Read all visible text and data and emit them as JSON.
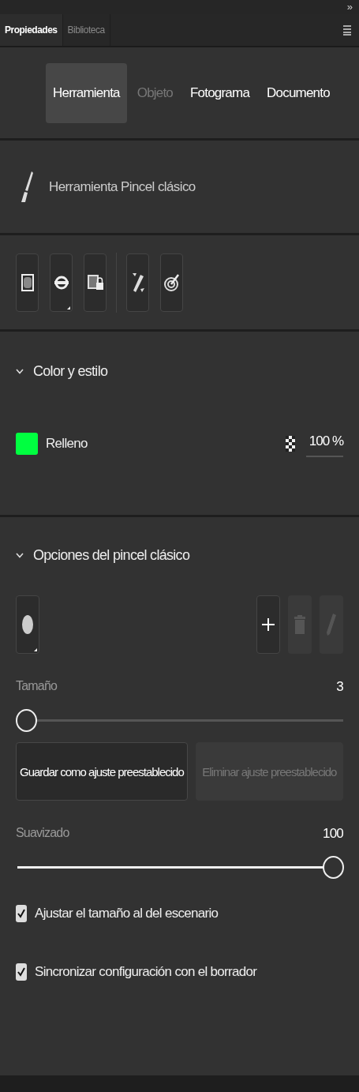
{
  "expand_glyph": "»",
  "panel_tabs": [
    {
      "label": "Propiedades",
      "selected": true
    },
    {
      "label": "Biblioteca",
      "selected": false
    }
  ],
  "mode_tabs": [
    {
      "label": "Herramienta",
      "selected": true,
      "disabled": false
    },
    {
      "label": "Objeto",
      "selected": false,
      "disabled": true
    },
    {
      "label": "Fotograma",
      "selected": false,
      "disabled": false
    },
    {
      "label": "Documento",
      "selected": false,
      "disabled": false
    }
  ],
  "tool": {
    "name": "Herramienta Pincel clásico"
  },
  "color_section": {
    "title": "Color y estilo",
    "expanded": true,
    "fill": {
      "label": "Relleno",
      "color": "#00ff40",
      "opacity": "100 %"
    }
  },
  "brush_section": {
    "title": "Opciones del pincel clásico",
    "expanded": true,
    "preset_actions": [
      {
        "kind": "add",
        "disabled": false
      },
      {
        "kind": "delete",
        "disabled": true
      },
      {
        "kind": "edit",
        "disabled": true
      }
    ],
    "size": {
      "label": "Tamaño",
      "reading": "3",
      "level": 0
    },
    "buttons": [
      {
        "label": "Guardar como ajuste preestablecido",
        "disabled": false
      },
      {
        "label": "Eliminar ajuste preestablecido",
        "disabled": true
      }
    ],
    "smoothing": {
      "label": "Suavizado",
      "reading": "100",
      "level": 1
    },
    "options": [
      {
        "label": "Ajustar el tamaño al del escenario",
        "checked": true
      },
      {
        "label": "Sincronizar configuración con el borrador",
        "checked": true
      }
    ]
  }
}
